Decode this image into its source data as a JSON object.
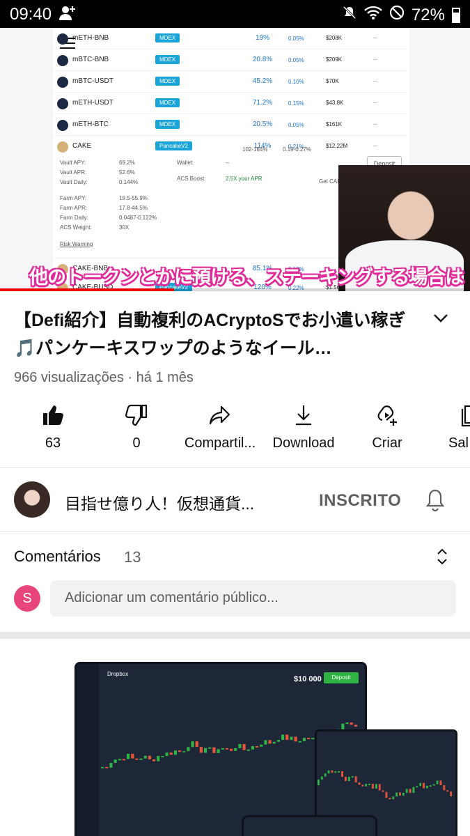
{
  "status_bar": {
    "time": "09:40",
    "battery": "72%"
  },
  "video": {
    "rows": [
      {
        "name": "mETH-BNB",
        "dex": "MDEX",
        "apy": "19%",
        "daily": "0.05%",
        "tvl": "$208K",
        "extra": "--"
      },
      {
        "name": "mBTC-BNB",
        "dex": "MDEX",
        "apy": "20.8%",
        "daily": "0.05%",
        "tvl": "$209K",
        "extra": "--"
      },
      {
        "name": "mBTC-USDT",
        "dex": "MDEX",
        "apy": "45.2%",
        "daily": "0.10%",
        "tvl": "$70K",
        "extra": "--"
      },
      {
        "name": "mETH-USDT",
        "dex": "MDEX",
        "apy": "71.2%",
        "daily": "0.15%",
        "tvl": "$43.8K",
        "extra": "--"
      },
      {
        "name": "mETH-BTC",
        "dex": "MDEX",
        "apy": "20.5%",
        "daily": "0.05%",
        "tvl": "$161K",
        "extra": "--"
      },
      {
        "name": "CAKE",
        "dex": "PancakeV2",
        "apy": "114%",
        "daily": "0.21%",
        "tvl": "$12.22M",
        "extra": "--"
      }
    ],
    "cake_apy_range": "102-164%",
    "cake_daily_range": "0.19-0.27%",
    "vault": {
      "apy_label": "Vault APY:",
      "apy": "69.2%",
      "apr_label": "Vault APR:",
      "apr": "52.6%",
      "daily_label": "Vault Daily:",
      "daily": "0.144%"
    },
    "wallet_label": "Wallet:",
    "wallet_value": "--",
    "acs_boost_label": "ACS Boost:",
    "acs_boost_value": "2.5X your APR",
    "get_cake": "Get CAKE: Acsi Finance",
    "farm": {
      "apy_label": "Farm APY:",
      "apy": "19.5-55.9%",
      "apr_label": "Farm APR:",
      "apr": "17.8-44.5%",
      "daily_label": "Farm Daily:",
      "daily": "0.0487-0.122%",
      "weight_label": "ACS Weight:",
      "weight": "30X"
    },
    "risk_warning": "Risk Warning",
    "deposit": "Deposit",
    "row7": {
      "name": "CAKE-BNB",
      "apy": "85.1%",
      "daily": "0.17%"
    },
    "row8": {
      "name": "CAKE-BUSD",
      "dex": "PancakeV2",
      "apy": "120%",
      "daily": "0.22%",
      "tvl": "$1.56"
    },
    "subtitle": "他のトークンとかに預ける、ステーキングする場合は",
    "progress": 0.37
  },
  "title": "【Defi紹介】自動複利のACryptoSでお小遣い稼ぎ🎵パンケーキスワップのようなイール…",
  "meta": "966 visualizações · há 1 mês",
  "actions": [
    {
      "label": "63"
    },
    {
      "label": "0"
    },
    {
      "label": "Compartil..."
    },
    {
      "label": "Download"
    },
    {
      "label": "Criar"
    },
    {
      "label": "Sal"
    }
  ],
  "channel": {
    "name": "目指せ億り人！仮想通貨...",
    "subscribe_label": "INSCRITO"
  },
  "comments": {
    "label": "Comentários",
    "count": "13",
    "avatar_letter": "S",
    "placeholder": "Adicionar um comentário público..."
  },
  "ad": {
    "brand": "Dropbox",
    "price": "$10 000",
    "deposit": "Deposit"
  }
}
